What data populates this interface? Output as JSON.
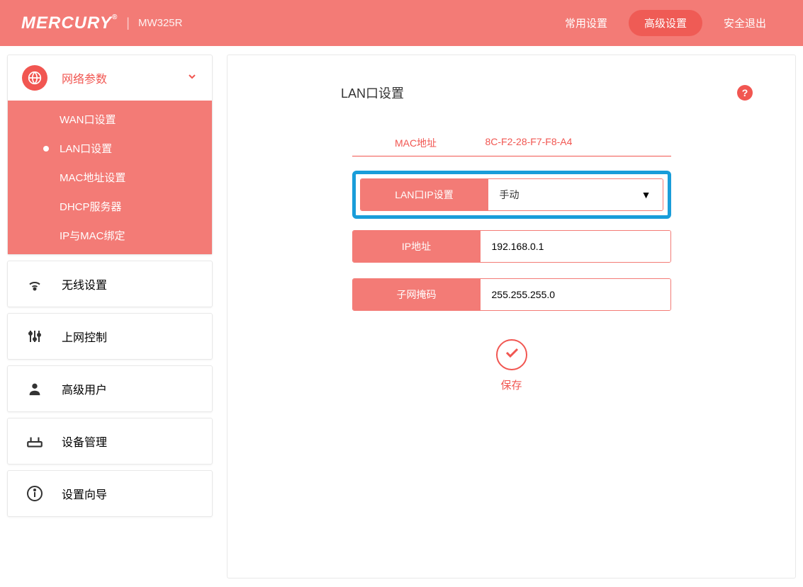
{
  "header": {
    "brand": "MERCURY",
    "model": "MW325R",
    "nav": {
      "common": "常用设置",
      "advanced": "高级设置",
      "logout": "安全退出"
    }
  },
  "sidebar": {
    "network": {
      "label": "网络参数",
      "items": {
        "wan": "WAN口设置",
        "lan": "LAN口设置",
        "mac": "MAC地址设置",
        "dhcp": "DHCP服务器",
        "ipmac": "IP与MAC绑定"
      }
    },
    "wireless": "无线设置",
    "access": "上网控制",
    "advanced_user": "高级用户",
    "device": "设备管理",
    "wizard": "设置向导"
  },
  "page": {
    "title": "LAN口设置",
    "mac_label": "MAC地址",
    "mac_value": "8C-F2-28-F7-F8-A4",
    "lan_ip_setting_label": "LAN口IP设置",
    "lan_ip_setting_value": "手动",
    "ip_label": "IP地址",
    "ip_value": "192.168.0.1",
    "subnet_label": "子网掩码",
    "subnet_value": "255.255.255.0",
    "save": "保存"
  }
}
